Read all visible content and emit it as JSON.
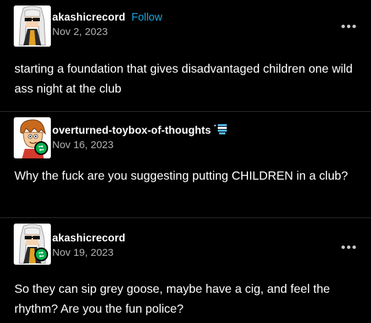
{
  "posts": [
    {
      "username": "akashicrecord",
      "follow_label": "Follow",
      "date": "Nov 2, 2023",
      "body": "starting a foundation that gives disadvantaged children one wild ass night at the club",
      "avatar_icon": "white-hair-sunglasses-avatar",
      "more_icon": "more-options-icon"
    },
    {
      "username": "overturned-toybox-of-thoughts",
      "date": "Nov 16, 2023",
      "body": "Why the fuck are you suggesting putting CHILDREN in a club?",
      "avatar_icon": "cartoon-boy-avatar",
      "badge_icon": "reblog-icon",
      "user_icon": "flag-icon"
    },
    {
      "username": "akashicrecord",
      "date": "Nov 19, 2023",
      "body": "So they can sip grey goose, maybe have a cig, and feel the rhythm? Are you the fun police?",
      "avatar_icon": "white-hair-sunglasses-avatar",
      "badge_icon": "reblog-icon",
      "more_icon": "more-options-icon"
    }
  ],
  "colors": {
    "background": "#000000",
    "text": "#ffffff",
    "secondary_text": "#b3b3b3",
    "follow_link": "#19a7e0",
    "reblog_badge": "#00b04f"
  }
}
